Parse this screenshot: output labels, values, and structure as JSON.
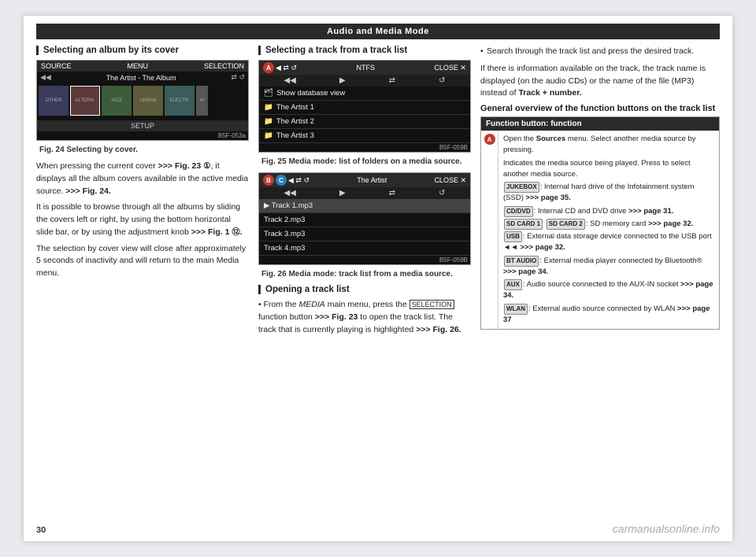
{
  "header": {
    "title": "Audio and Media Mode"
  },
  "page_number": "30",
  "left_section": {
    "title": "Selecting an album by its cover",
    "screen1": {
      "bar_left": "SOURCE",
      "bar_center": "MENU",
      "bar_right": "SELECTION",
      "track_info": "The Artist - The Album",
      "albums": [
        "OTHER",
        "ALTERN.",
        "JAZZ",
        "URBAN",
        "ELECTR."
      ],
      "bottom_bar": "SETUP",
      "fig_code": "B5F-053a",
      "fig_label": "Fig. 24",
      "fig_caption": "Selecting by cover."
    },
    "body_paragraphs": [
      "When pressing the current cover >>> Fig. 23 ①, it displays all the album covers available in the active media source. >>> Fig. 24.",
      "It is possible to browse through all the albums by sliding the covers left or right, by using the bottom horizontal slide bar, or by using the adjustment knob >>> Fig. 1 ⑫.",
      "The selection by cover view will close after approximately 5 seconds of inactivity and will return to the main Media menu."
    ]
  },
  "middle_section": {
    "title": "Selecting a track from a track list",
    "screen2": {
      "bar_left": "◀",
      "bar_icon": "⇄",
      "bar_right_label": "NTFS",
      "close_label": "CLOSE ✕",
      "badge_label": "A",
      "items": [
        "Show database view",
        "The Artist 1",
        "The Artist 2",
        "The Artist 3"
      ],
      "fig_code": "B5F-059B",
      "fig_label": "Fig. 25",
      "fig_caption": "Media mode: list of folders on a media source."
    },
    "screen3": {
      "bar_right": "The Artist",
      "close_label": "CLOSE ✕",
      "badge_b": "B",
      "badge_c": "C",
      "tracks": [
        "▶ Track 1.mp3",
        "Track 2.mp3",
        "Track 3.mp3",
        "Track 4.mp3"
      ],
      "fig_code": "B5F-059B",
      "fig_label": "Fig. 26",
      "fig_caption": "Media mode: track list from a media source."
    },
    "opening_title": "Opening a track list",
    "opening_text": "From the MEDIA main menu, press the SELECTION function button >>> Fig. 23 to open the track list. The track that is currently playing is highlighted >>> Fig. 26."
  },
  "right_section": {
    "bullet_text": "Search through the track list and press the desired track.",
    "info_text": "If there is information available on the track, the track name is displayed (on the audio CDs) or the name of the file (MP3) instead of Track + number.",
    "section_heading": "General overview of the function buttons on the track list",
    "table": {
      "header": "Function button: function",
      "rows": [
        {
          "badge": "A",
          "badge_color": "red",
          "text_parts": [
            {
              "type": "main",
              "text": "Open the Sources menu. Select another media source by pressing."
            },
            {
              "type": "sub",
              "text": "Indicates the media source being played. Press to select another media source."
            },
            {
              "type": "sub",
              "text": "JUKEBOX: Internal hard drive of the Infotainment system (SSD) >>> page 35."
            },
            {
              "type": "sub",
              "text": "CD/DVD: Internal CD and DVD drive >>> page 31."
            },
            {
              "type": "sub",
              "text": "SD CARD 1, SD CARD 2: SD memory card >>> page 32."
            },
            {
              "type": "sub",
              "text": "USB: External data storage device connected to the USB port ◄◄ >>> page 32."
            },
            {
              "type": "sub",
              "text": "BT AUDIO: External media player connected by Bluetooth® >>> page 34."
            },
            {
              "type": "sub",
              "text": "AUX: Audio source connected to the AUX-IN socket >>> page 34."
            },
            {
              "type": "sub",
              "text": "WLAN: External audio source connected by WLAN >>> page 37"
            }
          ]
        }
      ]
    }
  },
  "watermark": "carmanualsonline.info"
}
